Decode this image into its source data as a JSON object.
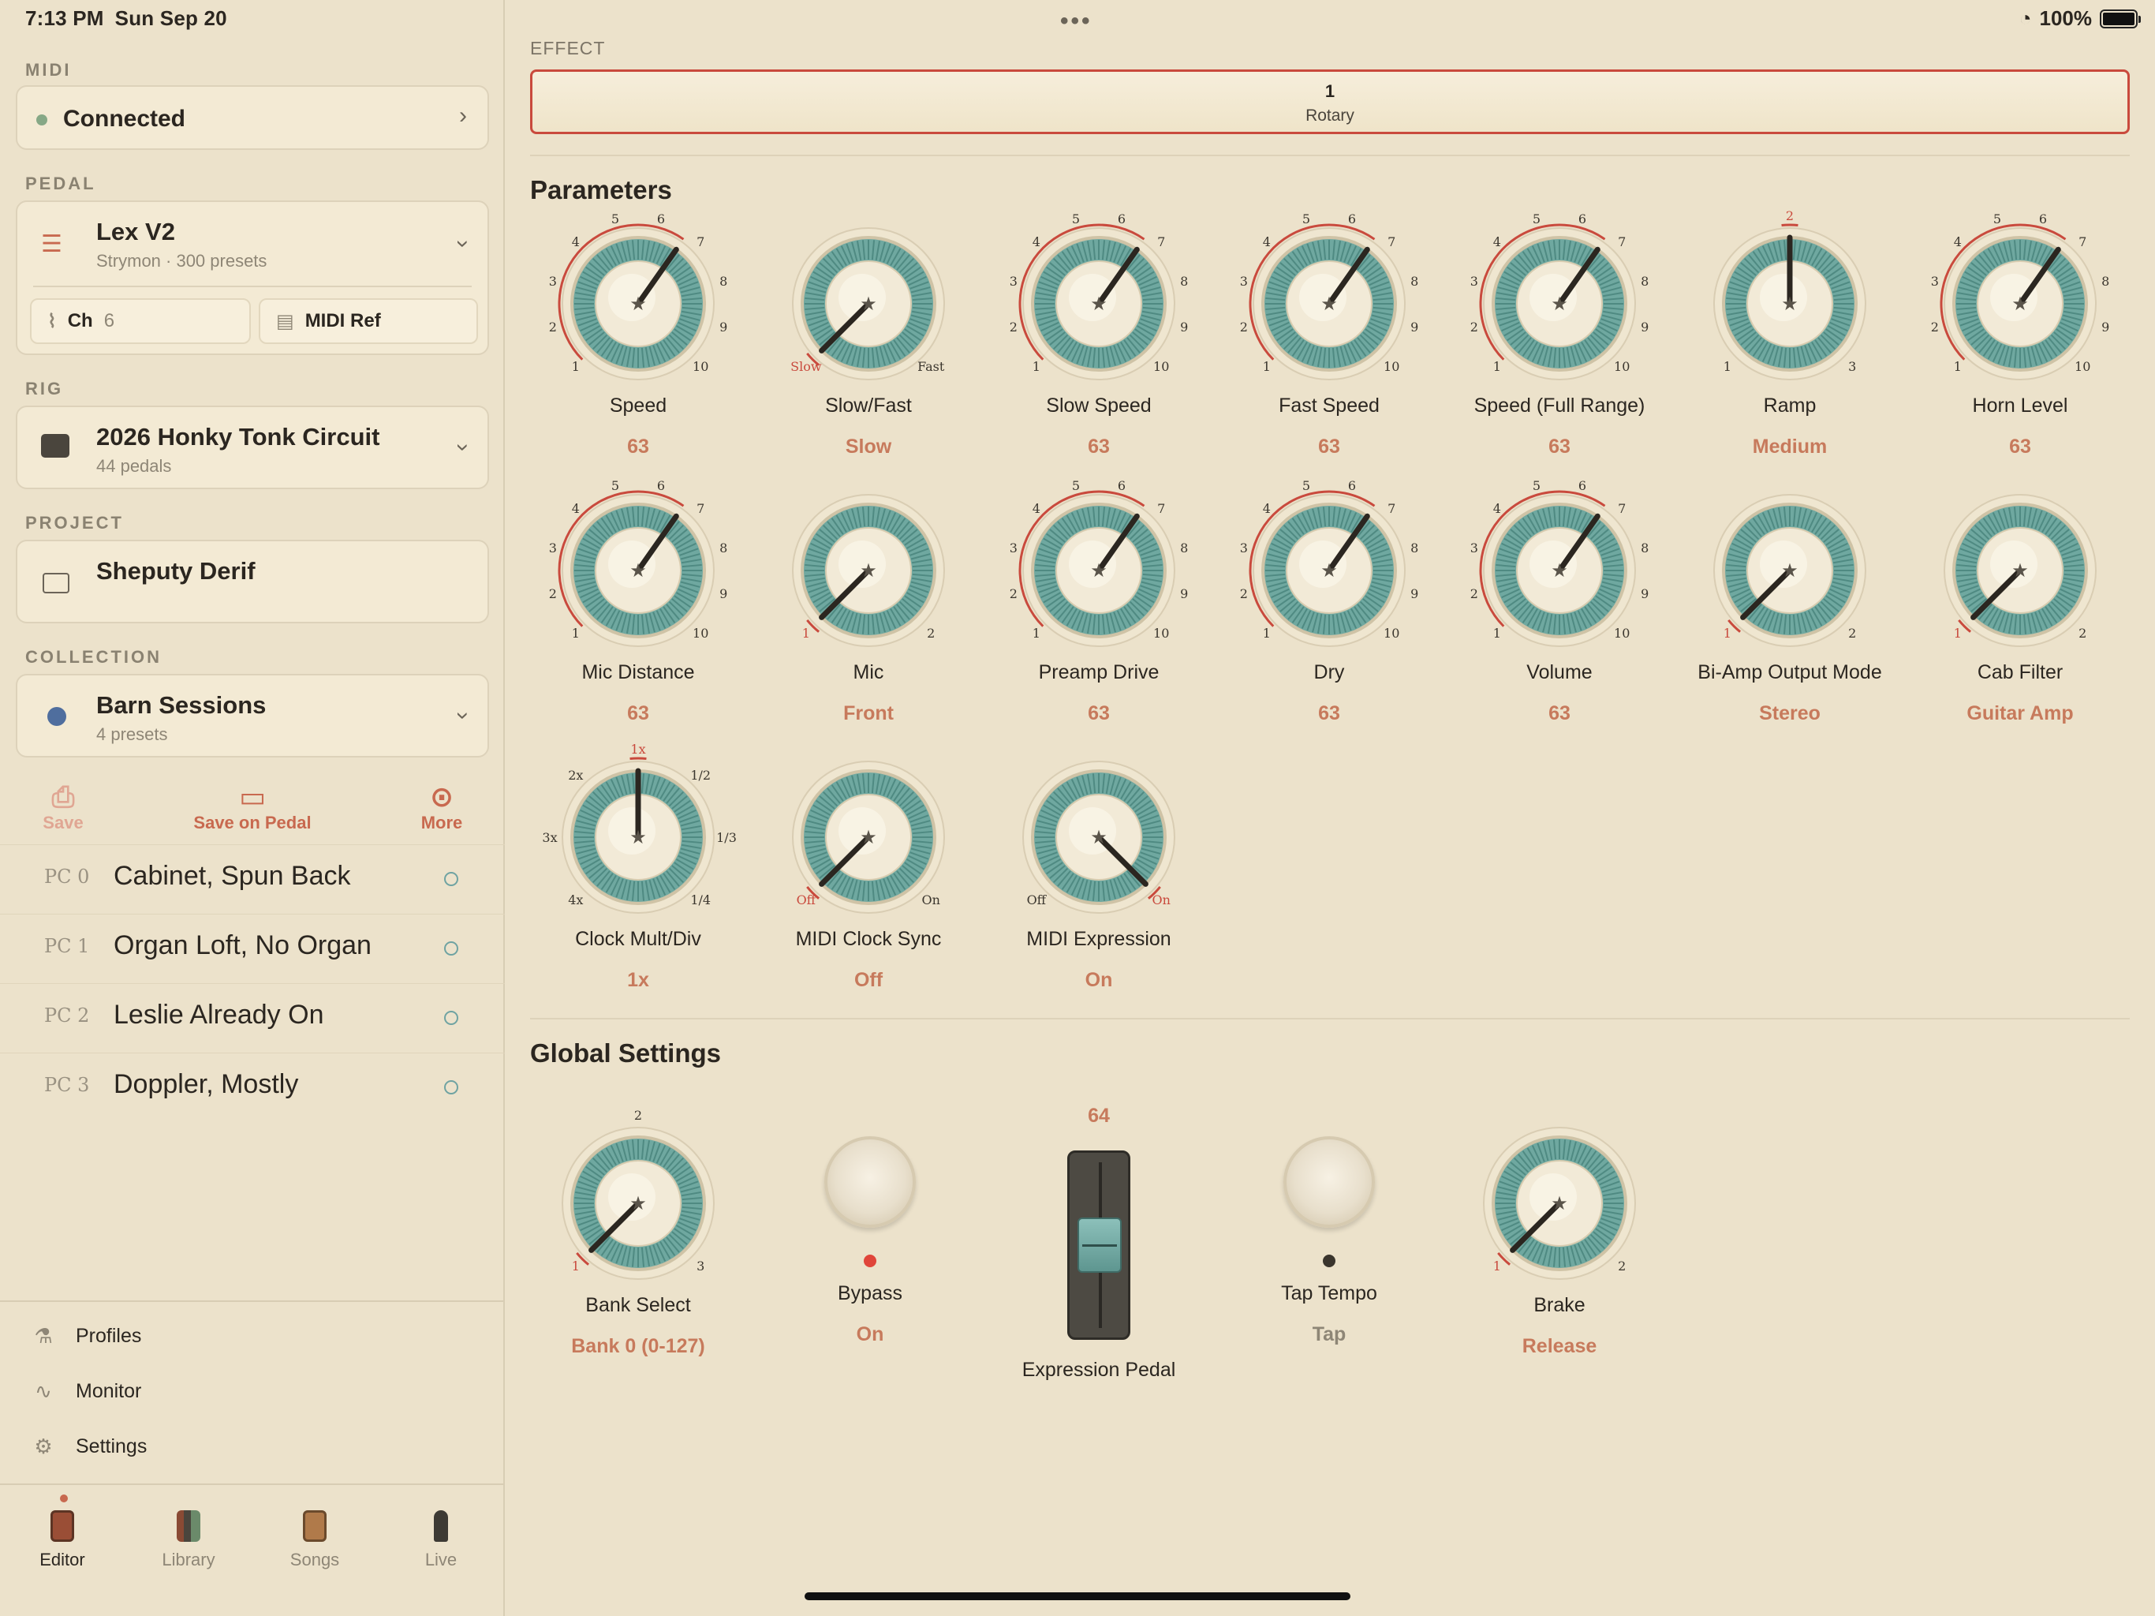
{
  "status": {
    "time": "7:13 PM",
    "date": "Sun Sep 20",
    "battery": "100%",
    "more": "•••"
  },
  "sidebar": {
    "midi": {
      "label": "MIDI",
      "status": "Connected"
    },
    "pedal": {
      "label": "PEDAL",
      "name": "Lex V2",
      "sub": "Strymon · 300 presets",
      "ch_label": "Ch",
      "ch_value": "6",
      "midi_ref": "MIDI Ref"
    },
    "rig": {
      "label": "RIG",
      "name": "2026 Honky Tonk Circuit",
      "sub": "44 pedals"
    },
    "project": {
      "label": "PROJECT",
      "name": "Sheputy Derif"
    },
    "collection": {
      "label": "COLLECTION",
      "name": "Barn Sessions",
      "sub": "4 presets",
      "dot_color": "#4f6e9e"
    },
    "actions": [
      {
        "label": "Save",
        "icon": "tray-download-icon"
      },
      {
        "label": "Save on Pedal",
        "icon": "chip-icon"
      },
      {
        "label": "More",
        "icon": "ellipsis-circle-icon"
      }
    ],
    "presets": [
      {
        "pc": "PC 0",
        "name": "Cabinet, Spun Back"
      },
      {
        "pc": "PC 1",
        "name": "Organ Loft, No Organ"
      },
      {
        "pc": "PC 2",
        "name": "Leslie Already On"
      },
      {
        "pc": "PC 3",
        "name": "Doppler, Mostly"
      }
    ],
    "bottom": [
      {
        "label": "Profiles",
        "icon": "profiles-icon"
      },
      {
        "label": "Monitor",
        "icon": "waveform-icon"
      },
      {
        "label": "Settings",
        "icon": "gear-icon"
      }
    ],
    "tabs": [
      {
        "label": "Editor"
      },
      {
        "label": "Library"
      },
      {
        "label": "Songs"
      },
      {
        "label": "Live"
      }
    ]
  },
  "effect": {
    "label": "EFFECT",
    "number": "1",
    "name": "Rotary"
  },
  "parameters": {
    "title": "Parameters",
    "knobs": [
      {
        "name": "Speed",
        "value": "63",
        "type": "range10",
        "level": 0.63
      },
      {
        "name": "Slow/Fast",
        "value": "Slow",
        "type": "two",
        "left": "Slow",
        "right": "Fast",
        "pos": 0
      },
      {
        "name": "Slow Speed",
        "value": "63",
        "type": "range10",
        "level": 0.63
      },
      {
        "name": "Fast Speed",
        "value": "63",
        "type": "range10",
        "level": 0.63
      },
      {
        "name": "Speed (Full Range)",
        "value": "63",
        "type": "range10",
        "level": 0.63
      },
      {
        "name": "Ramp",
        "value": "Medium",
        "type": "three",
        "labels": [
          "1",
          "2",
          "3"
        ],
        "pos": 1
      },
      {
        "name": "Horn Level",
        "value": "63",
        "type": "range10",
        "level": 0.63
      },
      {
        "name": "Mic Distance",
        "value": "63",
        "type": "range10",
        "level": 0.63
      },
      {
        "name": "Mic",
        "value": "Front",
        "type": "two",
        "left": "1",
        "right": "2",
        "pos": 0
      },
      {
        "name": "Preamp Drive",
        "value": "63",
        "type": "range10",
        "level": 0.63
      },
      {
        "name": "Dry",
        "value": "63",
        "type": "range10",
        "level": 0.63
      },
      {
        "name": "Volume",
        "value": "63",
        "type": "range10",
        "level": 0.63
      },
      {
        "name": "Bi-Amp Output Mode",
        "value": "Stereo",
        "type": "two",
        "left": "1",
        "right": "2",
        "pos": 0
      },
      {
        "name": "Cab Filter",
        "value": "Guitar Amp",
        "type": "two",
        "left": "1",
        "right": "2",
        "pos": 0
      },
      {
        "name": "Clock Mult/Div",
        "value": "1x",
        "type": "seven",
        "labels": [
          "4x",
          "3x",
          "2x",
          "1x",
          "1/2",
          "1/3",
          "1/4"
        ],
        "pos": 3
      },
      {
        "name": "MIDI Clock Sync",
        "value": "Off",
        "type": "two",
        "left": "Off",
        "right": "On",
        "pos": 0
      },
      {
        "name": "MIDI Expression",
        "value": "On",
        "type": "two",
        "left": "Off",
        "right": "On",
        "pos": 1
      }
    ]
  },
  "global": {
    "title": "Global Settings",
    "bank_select": {
      "name": "Bank Select",
      "value": "Bank 0 (0-127)",
      "labels": [
        "1",
        "2",
        "3"
      ],
      "pos": 0
    },
    "bypass": {
      "name": "Bypass",
      "value": "On",
      "led": "#e0453a"
    },
    "expression": {
      "name": "Expression Pedal",
      "value": "64",
      "level": 0.5
    },
    "tap": {
      "name": "Tap Tempo",
      "value": "Tap",
      "led": "#3a352d"
    },
    "brake": {
      "name": "Brake",
      "value": "Release",
      "left": "1",
      "right": "2",
      "pos": 0
    }
  },
  "colors": {
    "accent": "#c8694f",
    "knob_teal": "#6fa8a0",
    "arc_red": "#c94a3d",
    "selected_border": "#c94a3d"
  }
}
